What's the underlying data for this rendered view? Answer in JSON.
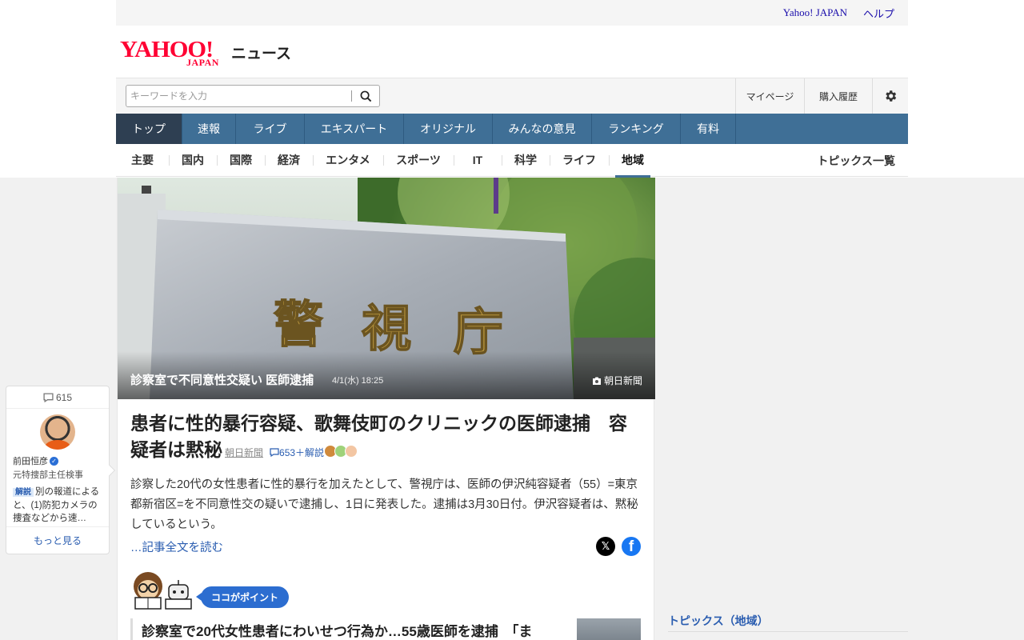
{
  "topbar": {
    "yahoo_japan": "Yahoo! JAPAN",
    "help": "ヘルプ"
  },
  "logo": {
    "yahoo": "YAHOO!",
    "japan": "JAPAN",
    "service": "ニュース"
  },
  "search": {
    "placeholder": "キーワードを入力",
    "icon": "search-icon"
  },
  "account": {
    "mypage": "マイページ",
    "history": "購入履歴",
    "settings_icon": "gear-icon"
  },
  "nav": [
    {
      "label": "トップ",
      "active": true
    },
    {
      "label": "速報"
    },
    {
      "label": "ライブ"
    },
    {
      "label": "エキスパート"
    },
    {
      "label": "オリジナル"
    },
    {
      "label": "みんなの意見"
    },
    {
      "label": "ランキング"
    },
    {
      "label": "有料"
    }
  ],
  "subnav": [
    {
      "label": "主要"
    },
    {
      "label": "国内"
    },
    {
      "label": "国際"
    },
    {
      "label": "経済"
    },
    {
      "label": "エンタメ"
    },
    {
      "label": "スポーツ"
    },
    {
      "label": "IT"
    },
    {
      "label": "科学"
    },
    {
      "label": "ライフ"
    },
    {
      "label": "地域",
      "active": true
    }
  ],
  "subnav_topics": "トピックス一覧",
  "hero": {
    "title": "診察室で不同意性交疑い 医師逮捕",
    "time": "4/1(水) 18:25",
    "source": "朝日新聞",
    "sign_text": "警視庁"
  },
  "article": {
    "headline": "患者に性的暴行容疑、歌舞伎町のクリニックの医師逮捕　容疑者は黙秘",
    "source": "朝日新聞",
    "comments": "653＋解説",
    "body": "診察した20代の女性患者に性的暴行を加えたとして、警視庁は、医師の伊沢純容疑者（55）=東京都新宿区=を不同意性交の疑いで逮捕し、1日に発表した。逮捕は3月30日付。伊沢容疑者は、黙秘しているという。",
    "readmore": "…記事全文を読む"
  },
  "point": {
    "badge": "ココがポイント"
  },
  "related": {
    "title": "診察室で20代女性患者にわいせつ行為か…55歳医師を逮捕　「ま"
  },
  "side": {
    "count": "615",
    "name": "前田恒彦",
    "role": "元特捜部主任検事",
    "tag": "解説",
    "text": "別の報道によると、(1)防犯カメラの捜査などから速…",
    "more": "もっと見る"
  },
  "topics_region": "トピックス（地域）",
  "colors": {
    "brand_red": "#ff0033",
    "nav_blue": "#3f6f96",
    "nav_active": "#2e3f52",
    "link": "#2a5db0"
  }
}
